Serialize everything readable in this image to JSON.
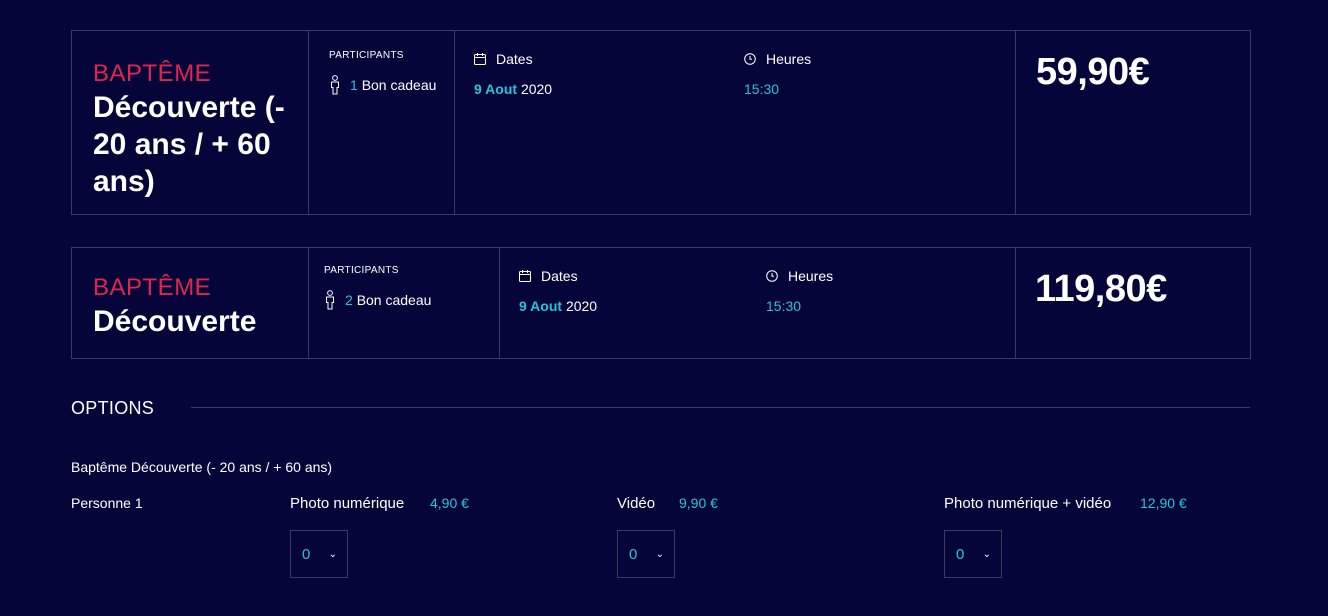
{
  "cards": [
    {
      "kind": "BAPTÊME",
      "name": "Découverte (- 20 ans / + 60 ans)",
      "participants_label": "PARTICIPANTS",
      "participant_count": "1",
      "participant_type": "Bon cadeau",
      "dates_label": "Dates",
      "date_day_month": "9 Aout",
      "date_year": "2020",
      "hours_label": "Heures",
      "hour": "15:30",
      "price": "59,90€"
    },
    {
      "kind": "BAPTÊME",
      "name": "Découverte",
      "participants_label": "PARTICIPANTS",
      "participant_count": "2",
      "participant_type": "Bon cadeau",
      "dates_label": "Dates",
      "date_day_month": "9 Aout",
      "date_year": "2020",
      "hours_label": "Heures",
      "hour": "15:30",
      "price": "119,80€"
    }
  ],
  "options": {
    "title": "OPTIONS",
    "product": "Baptême Découverte (- 20 ans / + 60 ans)",
    "person": "Personne 1",
    "items": [
      {
        "label": "Photo numérique",
        "price": "4,90 €",
        "qty": "0"
      },
      {
        "label": "Vidéo",
        "price": "9,90 €",
        "qty": "0"
      },
      {
        "label": "Photo numérique + vidéo",
        "price": "12,90 €",
        "qty": "0"
      }
    ]
  },
  "colors": {
    "background": "#06053a",
    "accent_red": "#e0264d",
    "accent_cyan": "#27c4d8",
    "border": "#3a3a64"
  },
  "icons": {
    "participant": "person-icon",
    "dates": "calendar-icon",
    "hours": "clock-icon",
    "select": "chevron-down-icon"
  }
}
